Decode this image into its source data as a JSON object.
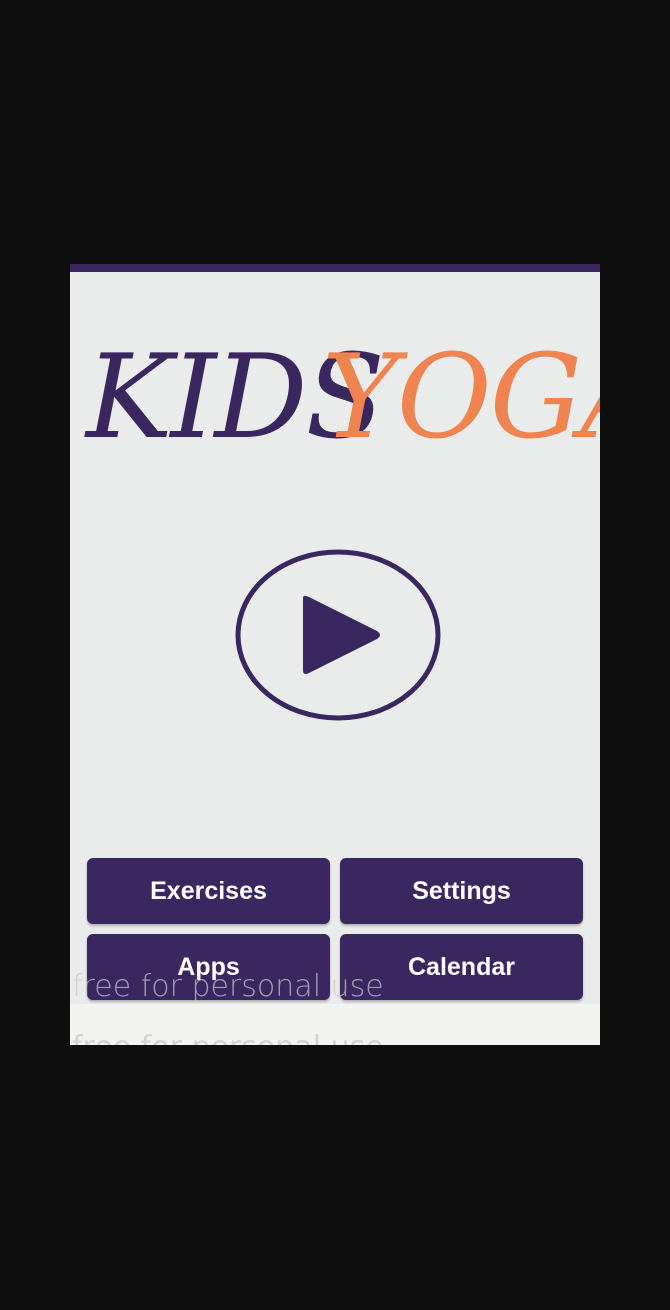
{
  "app": {
    "logo_word_1": "KIDS",
    "logo_word_2": "YOGA",
    "colors": {
      "primary": "#3a275f",
      "accent": "#f08450",
      "background": "#eaebeb"
    }
  },
  "play": {
    "icon": "play-icon"
  },
  "menu": {
    "exercises_label": "Exercises",
    "settings_label": "Settings",
    "apps_label": "Apps",
    "calendar_label": "Calendar"
  },
  "watermark": {
    "text": "free for personal use"
  }
}
